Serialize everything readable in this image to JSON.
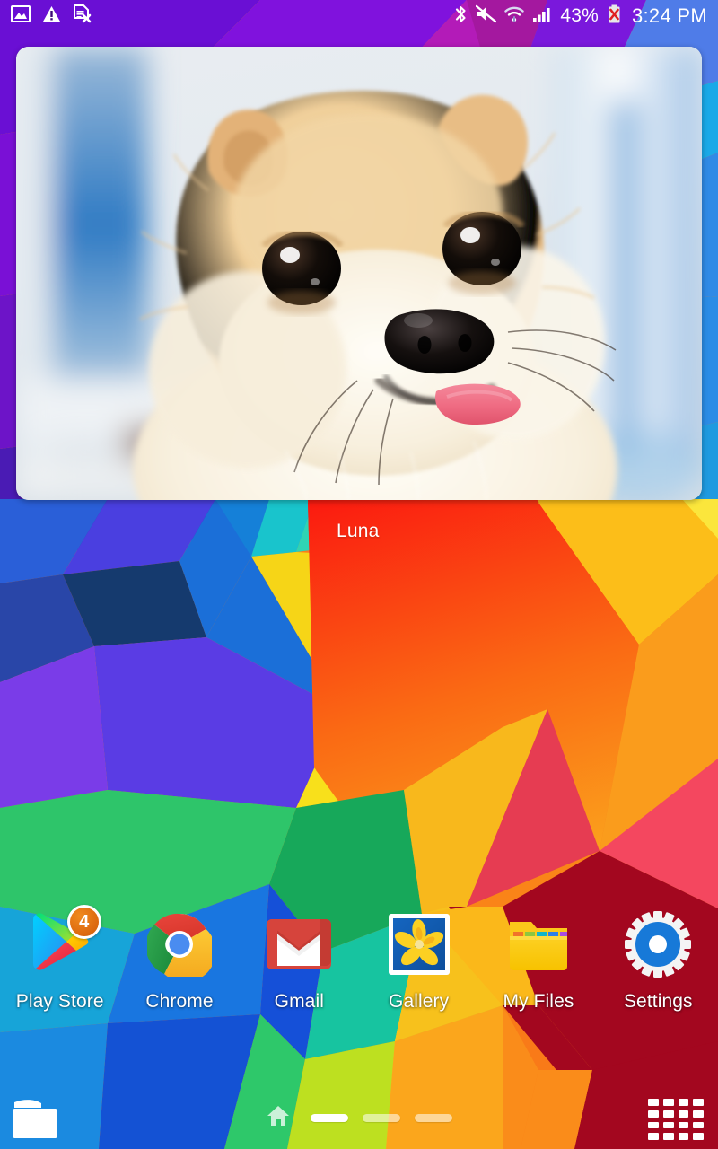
{
  "status_bar": {
    "left_icons": [
      {
        "name": "screenshot-image-icon",
        "label": "Screenshot captured"
      },
      {
        "name": "warning-triangle-icon",
        "label": "Warning"
      },
      {
        "name": "sim-card-error-icon",
        "label": "No SIM card"
      }
    ],
    "right_icons": [
      {
        "name": "bluetooth-icon",
        "label": "Bluetooth"
      },
      {
        "name": "sound-mute-icon",
        "label": "Sound muted"
      },
      {
        "name": "wifi-icon",
        "label": "Wi-Fi connected"
      },
      {
        "name": "cellular-signal-icon",
        "label": "Signal strength"
      }
    ],
    "battery_percent": "43%",
    "battery_icon": "battery-error-icon",
    "clock": "3:24 PM"
  },
  "widget": {
    "type": "photo-frame-widget",
    "caption": "Luna",
    "image_subject": "pomeranian-dog-photo"
  },
  "apps": [
    {
      "label": "Play Store",
      "icon": "play-store-icon",
      "badge": "4"
    },
    {
      "label": "Chrome",
      "icon": "chrome-icon",
      "badge": ""
    },
    {
      "label": "Gmail",
      "icon": "gmail-icon",
      "badge": ""
    },
    {
      "label": "Gallery",
      "icon": "gallery-icon",
      "badge": ""
    },
    {
      "label": "My Files",
      "icon": "my-files-icon",
      "badge": ""
    },
    {
      "label": "Settings",
      "icon": "settings-gear-icon",
      "badge": ""
    }
  ],
  "dock": {
    "folder_icon": "folder-icon",
    "home_icon": "home-icon",
    "apps_grid_icon": "apps-grid-icon",
    "page_count": 3,
    "active_page": 1
  },
  "colors": {
    "accent_badge": "#dd6a10",
    "status_text": "#ffffff",
    "label_text": "#ffffff",
    "active_dash": "#ffffff",
    "inactive_dash": "#f0b486"
  }
}
